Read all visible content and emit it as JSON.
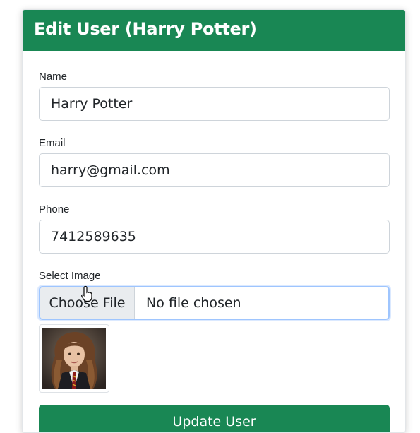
{
  "header": {
    "title": "Edit User (Harry Potter)"
  },
  "form": {
    "name": {
      "label": "Name",
      "value": "Harry Potter"
    },
    "email": {
      "label": "Email",
      "value": "harry@gmail.com"
    },
    "phone": {
      "label": "Phone",
      "value": "7412589635"
    },
    "image": {
      "label": "Select Image",
      "button_label": "Choose File",
      "status": "No file chosen"
    },
    "submit_label": "Update User"
  },
  "colors": {
    "brand": "#198754",
    "focus_border": "#9ec5fe"
  },
  "icons": {
    "cursor": "hand-pointer-icon"
  }
}
